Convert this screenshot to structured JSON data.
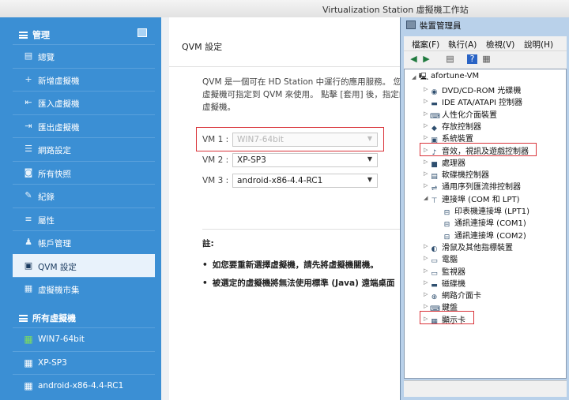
{
  "window": {
    "title": "Virtualization Station 虛擬機工作站"
  },
  "sidebar": {
    "section_manage": "管理",
    "items": [
      {
        "label": "總覽",
        "icon": "overview-icon",
        "glyph": "▤"
      },
      {
        "label": "新增虛擬機",
        "icon": "plus-icon",
        "glyph": "+"
      },
      {
        "label": "匯入虛擬機",
        "icon": "import-icon",
        "glyph": "⇤"
      },
      {
        "label": "匯出虛擬機",
        "icon": "export-icon",
        "glyph": "⇥"
      },
      {
        "label": "網路設定",
        "icon": "network-icon",
        "glyph": "☰"
      },
      {
        "label": "所有快照",
        "icon": "camera-icon",
        "glyph": "◙"
      },
      {
        "label": "紀錄",
        "icon": "log-icon",
        "glyph": "✎"
      },
      {
        "label": "屬性",
        "icon": "properties-icon",
        "glyph": "≡"
      },
      {
        "label": "帳戶管理",
        "icon": "users-icon",
        "glyph": "♟"
      },
      {
        "label": "QVM 設定",
        "icon": "qvm-icon",
        "glyph": "▣"
      },
      {
        "label": "虛擬機市集",
        "icon": "market-icon",
        "glyph": "▦"
      }
    ],
    "section_vms": "所有虛擬機",
    "vms": [
      {
        "label": "WIN7-64bit",
        "color": "#7ddc5e"
      },
      {
        "label": "XP-SP3",
        "color": "#ffffff"
      },
      {
        "label": "android-x86-4.4-RC1",
        "color": "#ffffff"
      }
    ]
  },
  "main": {
    "title": "QVM 設定",
    "description": [
      "QVM 是一個可在 HD Station 中運行的應用服務。 您",
      "虛擬機可指定到 QVM 來使用。 點擊 [套用] 後，指定的",
      "虛擬機。"
    ],
    "vm_rows": [
      {
        "label": "VM 1 :",
        "value": "WIN7-64bit",
        "disabled": true
      },
      {
        "label": "VM 2 :",
        "value": "XP-SP3",
        "disabled": false
      },
      {
        "label": "VM 3 :",
        "value": "android-x86-4.4-RC1",
        "disabled": false
      }
    ],
    "note_title": "註:",
    "notes": [
      "如您要重新選擇虛擬機，請先將虛擬機關機。",
      "被選定的虛擬機將無法使用標準 (Java) 遠端桌面"
    ]
  },
  "device_manager": {
    "title": "裝置管理員",
    "menu": [
      "檔案(F)",
      "執行(A)",
      "檢視(V)",
      "說明(H)"
    ],
    "root": "afortune-VM",
    "nodes": [
      {
        "label": "DVD/CD-ROM 光碟機",
        "icon": "dvd-icon"
      },
      {
        "label": "IDE ATA/ATAPI 控制器",
        "icon": "ide-icon"
      },
      {
        "label": "人性化介面裝置",
        "icon": "hid-icon"
      },
      {
        "label": "存放控制器",
        "icon": "storage-icon"
      },
      {
        "label": "系統裝置",
        "icon": "system-icon"
      },
      {
        "label": "音效，視訊及遊戲控制器",
        "icon": "sound-icon"
      },
      {
        "label": "處理器",
        "icon": "cpu-icon"
      },
      {
        "label": "軟碟機控制器",
        "icon": "floppy-icon"
      },
      {
        "label": "通用序列匯流排控制器",
        "icon": "usb-icon"
      },
      {
        "label": "連接埠 (COM 和 LPT)",
        "icon": "port-icon"
      },
      {
        "label": "印表機連接埠 (LPT1)",
        "icon": "lpt-icon"
      },
      {
        "label": "通訊連接埠 (COM1)",
        "icon": "com-icon"
      },
      {
        "label": "通訊連接埠 (COM2)",
        "icon": "com-icon"
      },
      {
        "label": "滑鼠及其他指標裝置",
        "icon": "mouse-icon"
      },
      {
        "label": "電腦",
        "icon": "computer-icon"
      },
      {
        "label": "監視器",
        "icon": "monitor-icon"
      },
      {
        "label": "磁碟機",
        "icon": "disk-icon"
      },
      {
        "label": "網路介面卡",
        "icon": "network-adapter-icon"
      },
      {
        "label": "鍵盤",
        "icon": "keyboard-icon"
      },
      {
        "label": "顯示卡",
        "icon": "display-adapter-icon"
      }
    ]
  },
  "colors": {
    "sidebar": "#3b8fd4",
    "highlight": "#d9343a"
  }
}
